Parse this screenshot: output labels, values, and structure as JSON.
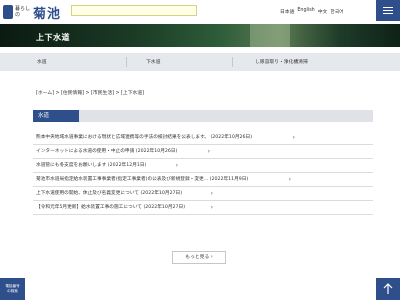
{
  "header": {
    "logo_small": "暮らしの",
    "logo_big": "菊池",
    "languages": [
      "日本語",
      "English",
      "中文",
      "한국어"
    ]
  },
  "hero": {
    "title": "上下水道"
  },
  "subnav": {
    "items": [
      "水道",
      "下水道",
      "し尿汲取り・浄化槽清掃"
    ]
  },
  "breadcrumb": "[ホーム] > [住民情報] > [市民生活] > [上下水道]",
  "section": {
    "title": "水道"
  },
  "news": [
    {
      "text": "熊本中央地域水道事業における現状と広域連携等の手法の検討結果を公表します。 (2022年10月26日)"
    },
    {
      "text": "インターネットによる水道の使用・中止の申請 (2022年10月26日)"
    },
    {
      "text": "水道管にも冬支度をお願いします (2022年12月1日)"
    },
    {
      "text": "菊池市水道局指定給水装置工事事業者(指定工事業者)の公表及び新規登録・変更... (2022年11月9日)"
    },
    {
      "text": "上下水道使用の開始、休止及び名義変更について (2022年10月27日)"
    },
    {
      "text": "【令和元年5月更新】給水装置工事の施工について (2022年10月27日)"
    }
  ],
  "more_button": "もっと見る",
  "page_search": [
    "電話番号",
    "の検索"
  ],
  "colors": {
    "brand": "#2e4f8c",
    "subnav_bg": "#e5e8ec",
    "search_bg": "#ffffe6"
  },
  "icons": {
    "menu": "hamburger-icon",
    "to_top": "arrow-up-icon",
    "chevron": "chevron-right-icon"
  }
}
